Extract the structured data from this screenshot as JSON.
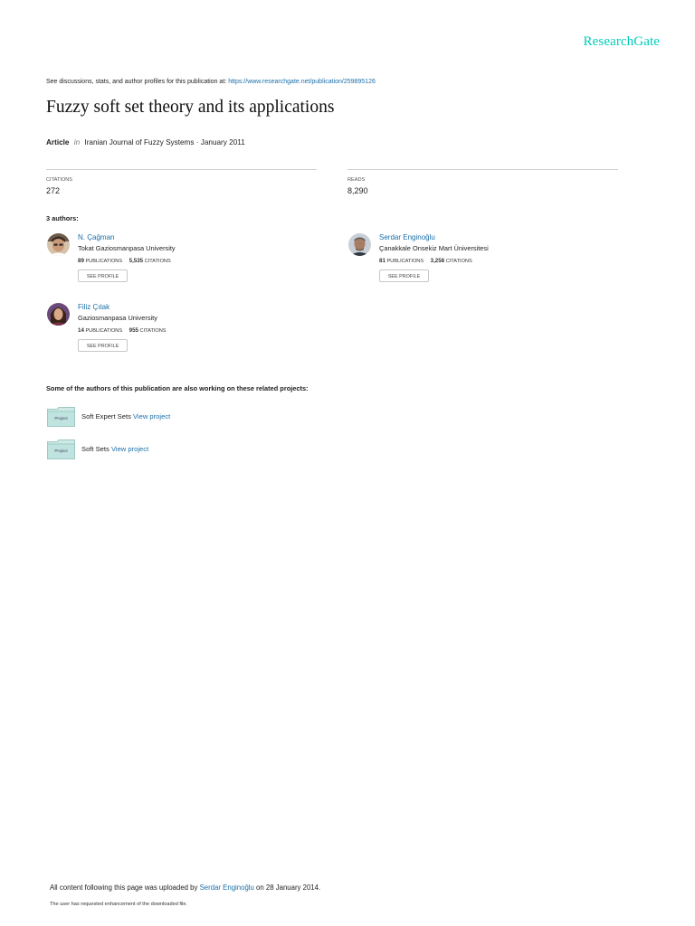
{
  "brand": "ResearchGate",
  "header": {
    "discussions_text": "See discussions, stats, and author profiles for this publication at:",
    "publication_url": "https://www.researchgate.net/publication/259895126"
  },
  "publication": {
    "title": "Fuzzy soft set theory and its applications",
    "type": "Article",
    "in_word": "in",
    "venue": "Iranian Journal of Fuzzy Systems · January 2011"
  },
  "stats": {
    "citations_label": "CITATIONS",
    "citations_value": "272",
    "reads_label": "READS",
    "reads_value": "8,290"
  },
  "authors_heading": "3 authors:",
  "authors": [
    {
      "name": "N. Çağman",
      "institution": "Tokat Gaziosmanpasa University",
      "publications": "89",
      "publications_label": "PUBLICATIONS",
      "citations": "5,535",
      "citations_label": "CITATIONS",
      "button": "SEE PROFILE"
    },
    {
      "name": "Serdar Enginoğlu",
      "institution": "Çanakkale Onsekiz Mart Üniversitesi",
      "publications": "81",
      "publications_label": "PUBLICATIONS",
      "citations": "3,258",
      "citations_label": "CITATIONS",
      "button": "SEE PROFILE"
    },
    {
      "name": "Filiz Çıtak",
      "institution": "Gaziosmanpasa University",
      "publications": "14",
      "publications_label": "PUBLICATIONS",
      "citations": "955",
      "citations_label": "CITATIONS",
      "button": "SEE PROFILE"
    }
  ],
  "projects_heading": "Some of the authors of this publication are also working on these related projects:",
  "projects": [
    {
      "icon_label": "Project",
      "name": "Soft Expert Sets",
      "link": "View project"
    },
    {
      "icon_label": "Project",
      "name": "Soft Sets",
      "link": "View project"
    }
  ],
  "footer": {
    "uploaded_prefix": "All content following this page was uploaded by",
    "uploader": "Serdar Enginoğlu",
    "uploaded_suffix": "on 28 January 2014.",
    "enhancement_note": "The user has requested enhancement of the downloaded file."
  },
  "colors": {
    "brand": "#00ccbb",
    "link": "#1a6fa8",
    "folder": "#cdeae6"
  }
}
